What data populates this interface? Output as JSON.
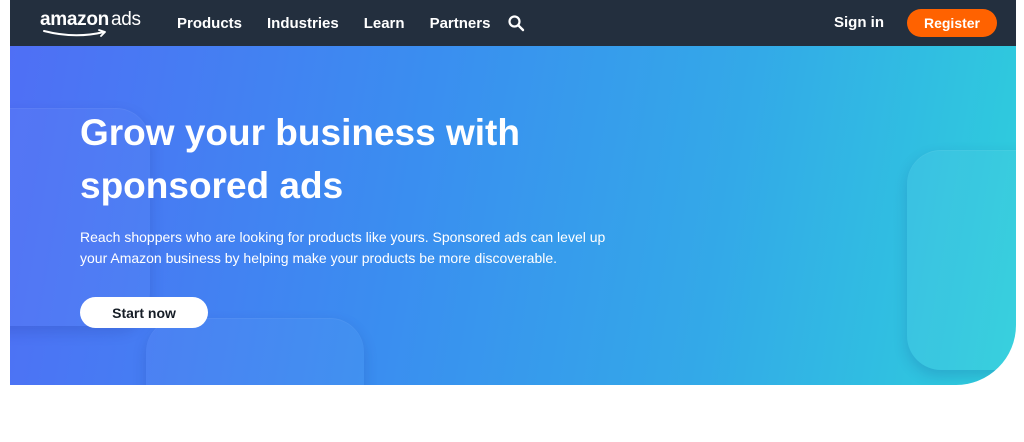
{
  "header": {
    "logo": {
      "brand": "amazon",
      "product": "ads"
    },
    "nav": [
      {
        "label": "Products"
      },
      {
        "label": "Industries"
      },
      {
        "label": "Learn"
      },
      {
        "label": "Partners"
      }
    ],
    "search_icon": "search-icon",
    "signin_label": "Sign in",
    "register_label": "Register"
  },
  "hero": {
    "title_line1": "Grow your business with",
    "title_line2": "sponsored ads",
    "subtitle_line1": "Reach shoppers who are looking for products like yours. Sponsored ads can level up",
    "subtitle_line2": "your Amazon business by helping make your products be more discoverable.",
    "cta_label": "Start now"
  },
  "colors": {
    "nav_bg": "#232f3e",
    "register_bg": "#ff6200",
    "hero_gradient_start": "#4f6ff5",
    "hero_gradient_end": "#2ecfdc"
  }
}
